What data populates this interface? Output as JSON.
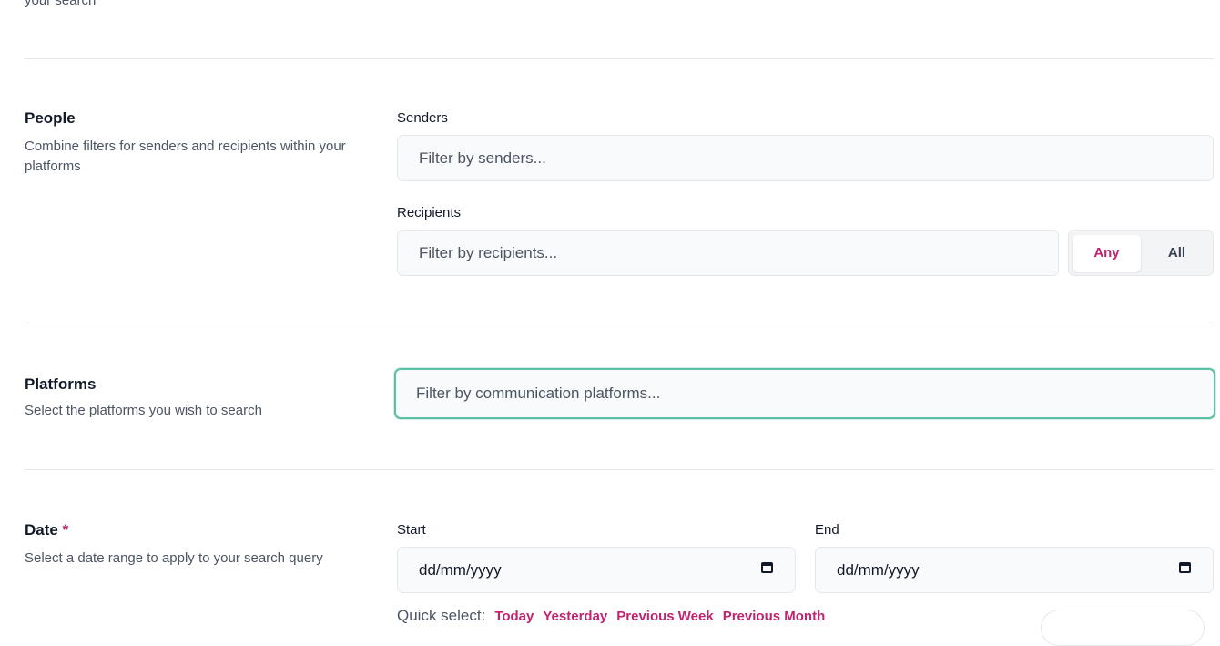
{
  "top": {
    "desc_tail": "your search"
  },
  "people": {
    "title": "People",
    "description": "Combine filters for senders and recipients within your platforms",
    "senders_label": "Senders",
    "senders_placeholder": "Filter by senders...",
    "recipients_label": "Recipients",
    "recipients_placeholder": "Filter by recipients...",
    "match_toggle": {
      "options": [
        "Any",
        "All"
      ],
      "selected": "Any"
    }
  },
  "platforms": {
    "title": "Platforms",
    "description": "Select the platforms you wish to search",
    "placeholder": "Filter by communication platforms..."
  },
  "date": {
    "title": "Date",
    "required_mark": "*",
    "description": "Select a date range to apply to your search query",
    "start_label": "Start",
    "start_value": "dd/mm/yyyy",
    "end_label": "End",
    "end_value": "dd/mm/yyyy",
    "quick_select_label": "Quick select:",
    "quick_options": [
      "Today",
      "Yesterday",
      "Previous Week",
      "Previous Month"
    ]
  },
  "colors": {
    "accent": "#c0246f",
    "focus_ring": "#5fbfa6",
    "border": "#e5e7eb"
  },
  "icons": {
    "calendar": "calendar-icon"
  }
}
